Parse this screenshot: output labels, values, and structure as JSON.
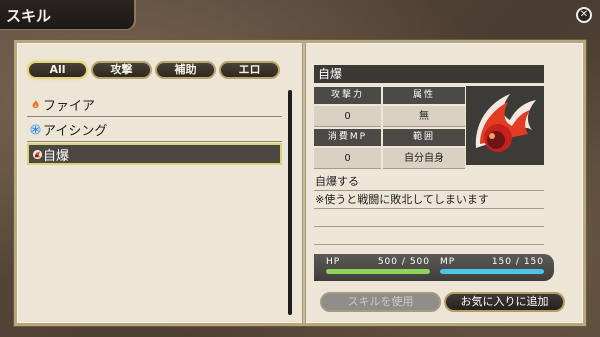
{
  "title": "スキル",
  "tabs": [
    "All",
    "攻撃",
    "補助",
    "エロ"
  ],
  "skills": [
    {
      "label": "ファイア",
      "icon": "fire-icon",
      "color": "#f0702a"
    },
    {
      "label": "アイシング",
      "icon": "ice-icon",
      "color": "#5aa6e8"
    },
    {
      "label": "自爆",
      "icon": "explosion-icon",
      "color": "#e24a2a"
    }
  ],
  "detail": {
    "name": "自爆",
    "stats": {
      "attack_label": "攻撃力",
      "attack_value": "0",
      "element_label": "属性",
      "element_value": "無",
      "mp_label": "消費MP",
      "mp_value": "0",
      "range_label": "範囲",
      "range_value": "自分自身"
    },
    "description": [
      "自爆する",
      "※使うと戦闘に敗北してしまいます",
      "",
      "",
      ""
    ]
  },
  "hp": {
    "label": "HP",
    "current": "500",
    "sep": "/",
    "max": "500",
    "fill": 1.0,
    "color": "#8fd35a"
  },
  "mp": {
    "label": "MP",
    "current": "150",
    "sep": "/",
    "max": "150",
    "fill": 1.0,
    "color": "#4fc4e8"
  },
  "buttons": {
    "use": "スキルを使用",
    "favorite": "お気に入りに追加"
  }
}
